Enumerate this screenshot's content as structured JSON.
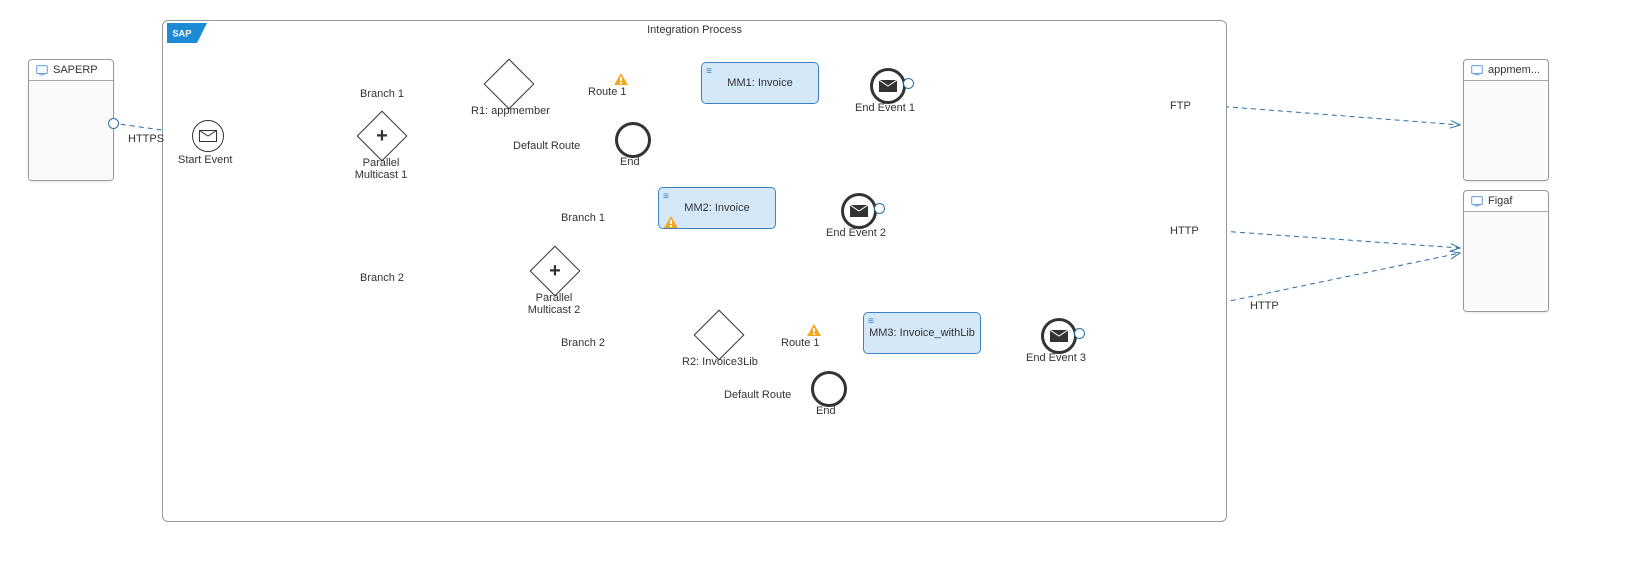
{
  "participants": {
    "left": {
      "name": "SAPERP"
    },
    "right1": {
      "name": "appmem..."
    },
    "right2": {
      "name": "Figaf"
    }
  },
  "pool": {
    "title": "Integration Process"
  },
  "events": {
    "start": {
      "label": "Start Event"
    },
    "end1": {
      "label": "End Event 1"
    },
    "end2": {
      "label": "End Event 2"
    },
    "end3": {
      "label": "End Event 3"
    },
    "endA": {
      "label": "End"
    },
    "endB": {
      "label": "End"
    }
  },
  "gateways": {
    "pm1": {
      "label": "Parallel Multicast 1"
    },
    "pm2": {
      "label": "Parallel Multicast 2"
    },
    "r1": {
      "label": "R1: appmember"
    },
    "r2": {
      "label": "R2: Invoice3Lib"
    }
  },
  "tasks": {
    "mm1": {
      "label": "MM1: Invoice"
    },
    "mm2": {
      "label": "MM2: Invoice"
    },
    "mm3": {
      "label": "MM3: Invoice_withLib"
    }
  },
  "edges": {
    "https": "HTTPS",
    "branch1a": "Branch 1",
    "branch2a": "Branch 2",
    "branch1b": "Branch 1",
    "branch2b": "Branch 2",
    "route1a": "Route 1",
    "route1b": "Route 1",
    "default1": "Default Route",
    "default2": "Default Route",
    "ftp": "FTP",
    "http1": "HTTP",
    "http2": "HTTP"
  }
}
